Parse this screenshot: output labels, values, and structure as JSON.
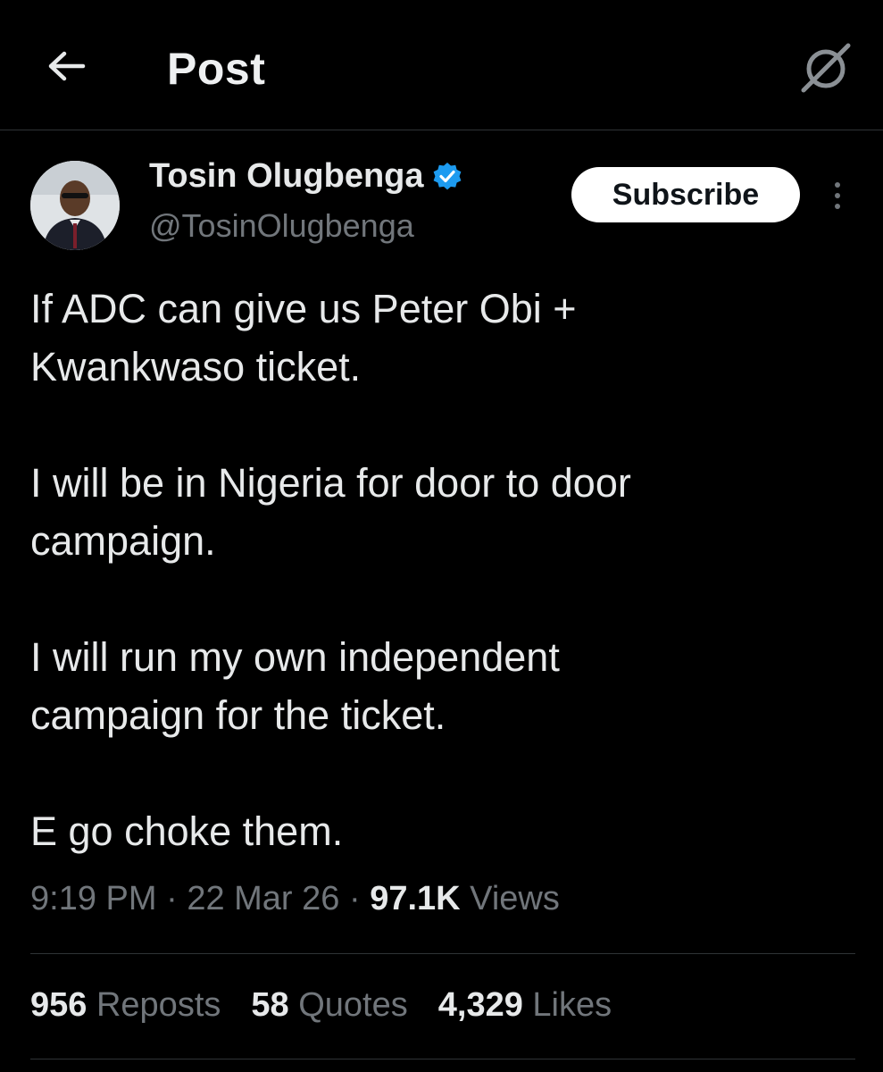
{
  "header": {
    "title": "Post",
    "back_icon": "arrow-left-icon",
    "grok_icon": "grok-icon"
  },
  "author": {
    "name": "Tosin Olugbenga",
    "handle": "@TosinOlugbenga",
    "verified": true,
    "verified_color": "#1d9bf0",
    "subscribe_label": "Subscribe"
  },
  "tweet": {
    "lines": [
      "If ADC can give us Peter Obi +",
      "Kwankwaso ticket.",
      "I will be in Nigeria for door to door",
      "campaign.",
      "I will run my own independent",
      "campaign for the ticket.",
      "E go choke them."
    ],
    "time": "9:19 PM",
    "separator": "·",
    "date": "22 Mar 26",
    "views_count": "97.1K",
    "views_label": "Views"
  },
  "stats": {
    "reposts_count": "956",
    "reposts_label": "Reposts",
    "quotes_count": "58",
    "quotes_label": "Quotes",
    "likes_count": "4,329",
    "likes_label": "Likes"
  },
  "colors": {
    "background": "#000000",
    "text_primary": "#e7e9ea",
    "text_secondary": "#71767b",
    "divider": "#2f3336"
  }
}
